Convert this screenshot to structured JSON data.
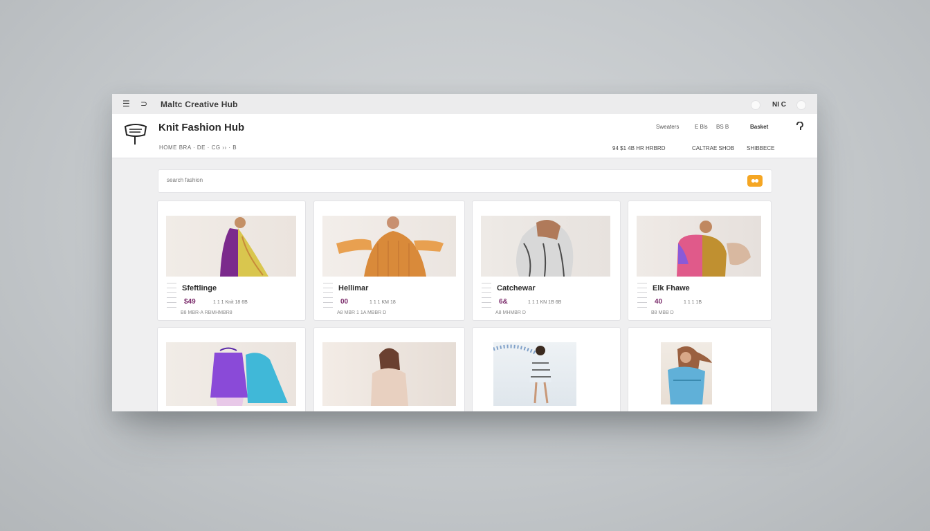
{
  "titlebar": {
    "title": "Maltc Creative Hub",
    "menu_icon": "hamburger-icon",
    "back_icon": "back-icon",
    "right_text": "NI C"
  },
  "header": {
    "brand": "Knit Fashion Hub",
    "subnav": "HOME BRA · DE · CG ›› · B",
    "links": [
      "Sweaters",
      "E Bls",
      "BS B",
      "Basket"
    ],
    "right_links": [
      "94 $1 4B  HR HRBRD",
      "CALTRAE SHOB",
      "SHIBBECE"
    ],
    "user_icon": "user-icon"
  },
  "search": {
    "placeholder": "search fashion",
    "button_icon": "search-icon",
    "accent": "#f5a623"
  },
  "products": [
    {
      "title": "Sfeftlinge",
      "price": "$49",
      "meta": "1  1  1  Knit 18  6B",
      "desc": "B8 MBR-A RBMHMBR8",
      "palette": [
        "#7b2a8c",
        "#d9c64e",
        "#c78a3a"
      ]
    },
    {
      "title": "Hellimar",
      "price": "00",
      "meta": "1  1  1  KM 18",
      "desc": "A8 MBR 1 1A MBBR D",
      "palette": [
        "#d98a3a",
        "#e8b26b",
        "#c07030"
      ]
    },
    {
      "title": "Catchewar",
      "price": "6&",
      "meta": "1  1  1  KN 1B 6B",
      "desc": "A8 MHMBR D",
      "palette": [
        "#b07a5a",
        "#d8d8d8",
        "#4a4a4a"
      ]
    },
    {
      "title": "Elk Fhawe",
      "price": "40",
      "meta": "1  1  1  1B",
      "desc": "B8 MBB D",
      "palette": [
        "#e05a8a",
        "#8a5ad8",
        "#c09030"
      ]
    },
    {
      "title": "",
      "price": "",
      "meta": "",
      "desc": "",
      "palette": [
        "#8a4ad8",
        "#40b8d8",
        "#a070e8"
      ]
    },
    {
      "title": "",
      "price": "",
      "meta": "",
      "desc": "",
      "palette": [
        "#e8d0c0",
        "#b08060",
        "#f3ece6"
      ]
    },
    {
      "title": "",
      "price": "",
      "meta": "",
      "desc": "",
      "palette": [
        "#7fa0c8",
        "#ffffff",
        "#404040"
      ]
    },
    {
      "title": "",
      "price": "",
      "meta": "",
      "desc": "",
      "palette": [
        "#60b0d8",
        "#9a6040",
        "#e8d8c8"
      ]
    }
  ]
}
